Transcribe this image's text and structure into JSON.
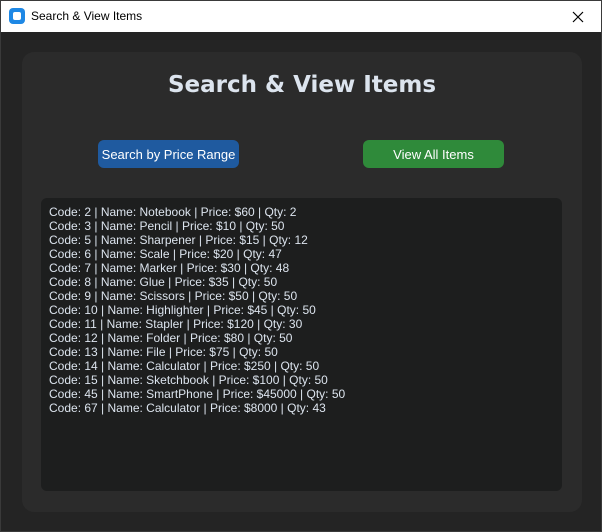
{
  "window": {
    "title": "Search & View Items",
    "close_icon": "close-icon"
  },
  "main": {
    "heading": "Search & View Items",
    "search_button_label": "Search by Price Range",
    "view_all_button_label": "View All Items",
    "results": [
      "Code: 2 | Name: Notebook | Price: $60 | Qty: 2",
      "Code: 3 | Name: Pencil | Price: $10 | Qty: 50",
      "Code: 5 | Name: Sharpener | Price: $15 | Qty: 12",
      "Code: 6 | Name: Scale | Price: $20 | Qty: 47",
      "Code: 7 | Name: Marker | Price: $30 | Qty: 48",
      "Code: 8 | Name: Glue | Price: $35 | Qty: 50",
      "Code: 9 | Name: Scissors | Price: $50 | Qty: 50",
      "Code: 10 | Name: Highlighter | Price: $45 | Qty: 50",
      "Code: 11 | Name: Stapler | Price: $120 | Qty: 30",
      "Code: 12 | Name: Folder | Price: $80 | Qty: 50",
      "Code: 13 | Name: File | Price: $75 | Qty: 50",
      "Code: 14 | Name: Calculator | Price: $250 | Qty: 50",
      "Code: 15 | Name: Sketchbook | Price: $100 | Qty: 50",
      "Code: 45 | Name: SmartPhone | Price: $45000 | Qty: 50",
      "Code: 67 | Name: Calculator | Price: $8000 | Qty: 43"
    ]
  },
  "colors": {
    "background": "#242424",
    "frame": "#2b2b2b",
    "textbox": "#1d1e1e",
    "search_button": "#1f5a9f",
    "view_button": "#2f8a3a",
    "text": "#dce4ee"
  }
}
